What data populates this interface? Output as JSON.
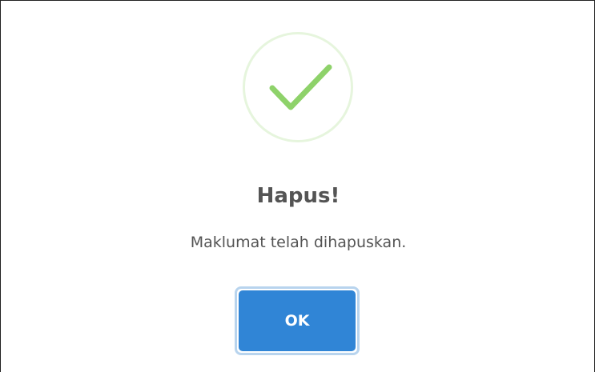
{
  "dialog": {
    "title": "Hapus!",
    "message": "Maklumat telah dihapuskan.",
    "confirm_label": "OK",
    "icon": "success-check-icon"
  },
  "colors": {
    "success": "#8ed26a",
    "success_ring": "#e6f5dd",
    "button": "#3085d6",
    "button_focus_ring": "#b8d4ee",
    "text": "#545454"
  }
}
